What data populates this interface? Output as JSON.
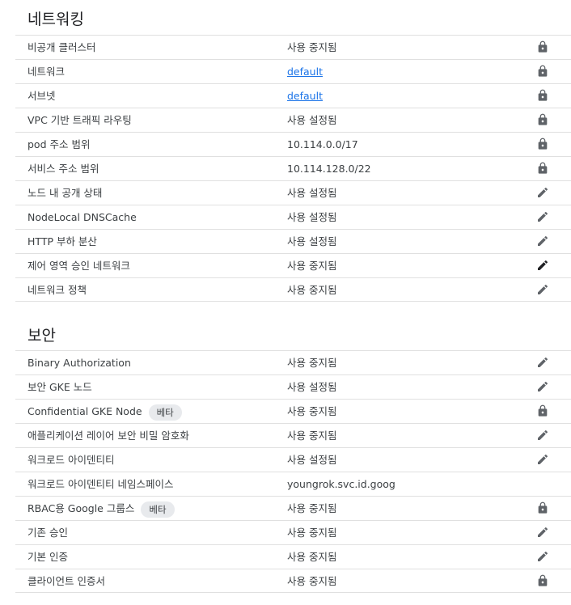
{
  "networking": {
    "title": "네트워킹",
    "rows": [
      {
        "label": "비공개 클러스터",
        "value": "사용 중지됨",
        "link": false,
        "icon": "lock-icon"
      },
      {
        "label": "네트워크",
        "value": "default",
        "link": true,
        "icon": "lock-icon"
      },
      {
        "label": "서브넷",
        "value": "default",
        "link": true,
        "icon": "lock-icon"
      },
      {
        "label": "VPC 기반 트래픽 라우팅",
        "value": "사용 설정됨",
        "link": false,
        "icon": "lock-icon"
      },
      {
        "label": "pod 주소 범위",
        "value": "10.114.0.0/17",
        "link": false,
        "icon": "lock-icon"
      },
      {
        "label": "서비스 주소 범위",
        "value": "10.114.128.0/22",
        "link": false,
        "icon": "lock-icon"
      },
      {
        "label": "노드 내 공개 상태",
        "value": "사용 설정됨",
        "link": false,
        "icon": "edit-icon"
      },
      {
        "label": "NodeLocal DNSCache",
        "value": "사용 설정됨",
        "link": false,
        "icon": "edit-icon"
      },
      {
        "label": "HTTP 부하 분산",
        "value": "사용 설정됨",
        "link": false,
        "icon": "edit-icon"
      },
      {
        "label": "제어 영역 승인 네트워크",
        "value": "사용 중지됨",
        "link": false,
        "icon": "edit-icon-dark"
      },
      {
        "label": "네트워크 정책",
        "value": "사용 중지됨",
        "link": false,
        "icon": "edit-icon"
      }
    ]
  },
  "security": {
    "title": "보안",
    "rows": [
      {
        "label": "Binary Authorization",
        "value": "사용 중지됨",
        "link": false,
        "icon": "edit-icon"
      },
      {
        "label": "보안 GKE 노드",
        "value": "사용 설정됨",
        "link": false,
        "icon": "edit-icon"
      },
      {
        "label": "Confidential GKE Node",
        "badge": "베타",
        "value": "사용 중지됨",
        "link": false,
        "icon": "lock-icon"
      },
      {
        "label": "애플리케이션 레이어 보안 비밀 암호화",
        "value": "사용 중지됨",
        "link": false,
        "icon": "edit-icon"
      },
      {
        "label": "워크로드 아이덴티티",
        "value": "사용 설정됨",
        "link": false,
        "icon": "edit-icon"
      },
      {
        "label": "워크로드 아이덴티티 네임스페이스",
        "value": "youngrok.svc.id.goog",
        "link": false,
        "icon": ""
      },
      {
        "label": "RBAC용 Google 그룹스",
        "badge": "베타",
        "value": "사용 중지됨",
        "link": false,
        "icon": "lock-icon"
      },
      {
        "label": "기존 승인",
        "value": "사용 중지됨",
        "link": false,
        "icon": "edit-icon"
      },
      {
        "label": "기본 인증",
        "value": "사용 중지됨",
        "link": false,
        "icon": "edit-icon"
      },
      {
        "label": "클라이언트 인증서",
        "value": "사용 중지됨",
        "link": false,
        "icon": "lock-icon"
      }
    ]
  },
  "colors": {
    "icon": "#5f6368",
    "icon_dark": "#202124",
    "link": "#1a73e8",
    "divider": "#e0e0e0",
    "badge_bg": "#e8eaed"
  }
}
